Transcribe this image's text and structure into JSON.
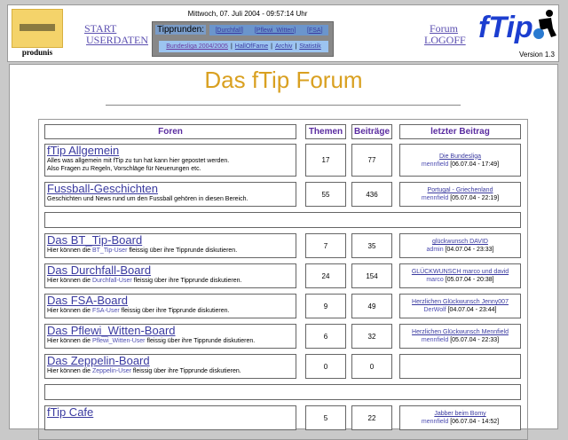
{
  "header": {
    "username": "produnis",
    "start": "START",
    "userdaten": "USERDATEN",
    "date": "Mittwoch, 07. Juli 2004 - 09:57:14 Uhr",
    "tipprunden_label": "Tipprunden:",
    "tipprunden": [
      "[Durchfall]",
      "[Pflewi_Witten]",
      "[FSA]"
    ],
    "links": [
      "Bundesliga 2004/2005",
      "HallOfFame",
      "Archiv",
      "Statistik"
    ],
    "forum": "Forum",
    "logoff": "LOGOFF",
    "logo": "fTip",
    "version": "Version 1.3"
  },
  "main": {
    "title": "Das fTip Forum",
    "columns": [
      "Foren",
      "Themen",
      "Beiträge",
      "letzter Beitrag"
    ],
    "forums": [
      {
        "name": "fTip Allgemein",
        "desc": "Alles was allgemein mit fTip zu tun hat kann hier gepostet werden.",
        "desc2": "Also Fragen zu Regeln, Vorschläge für Neuerungen etc.",
        "themen": "17",
        "beitraege": "77",
        "last_title": "Die Bundesliga",
        "last_user": "mennfield",
        "last_date": "[06.07.04 - 17:49]"
      },
      {
        "name": "Fussball-Geschichten",
        "desc": "Geschichten und News rund um den Fussball gehören in diesen Bereich.",
        "themen": "55",
        "beitraege": "436",
        "last_title": "Portugal - Griechenland",
        "last_user": "mennfield",
        "last_date": "[05.07.04 - 22:19]"
      },
      {
        "name": "Das BT_Tip-Board",
        "pre": "Hier können die ",
        "group": "BT_Tip-User",
        "post": " fleissig über ihre Tipprunde diskutieren.",
        "themen": "7",
        "beitraege": "35",
        "last_title": "glückwunsch DAVID",
        "last_user": "admin",
        "last_date": "[04.07.04 - 23:33]"
      },
      {
        "name": "Das Durchfall-Board",
        "pre": "Hier können die ",
        "group": "Durchfall-User",
        "post": " fleissig über ihre Tipprunde diskutieren.",
        "themen": "24",
        "beitraege": "154",
        "last_title": "GLÜCKWUNSCH marco und david",
        "last_user": "marco",
        "last_date": "[05.07.04 - 20:38]"
      },
      {
        "name": "Das FSA-Board",
        "pre": "Hier können die ",
        "group": "FSA-User",
        "post": " fleissig über ihre Tipprunde diskutieren.",
        "themen": "9",
        "beitraege": "49",
        "last_title": "Herzlichen Glückwunsch Jenny007",
        "last_user": "DerWolf",
        "last_date": "[04.07.04 - 23:44]"
      },
      {
        "name": "Das Pflewi_Witten-Board",
        "pre": "Hier können die ",
        "group": "Pflewi_Witten-User",
        "post": " fleissig über ihre Tipprunde diskutieren.",
        "themen": "6",
        "beitraege": "32",
        "last_title": "Herzlichen Glückwunsch Mennfield",
        "last_user": "mennfield",
        "last_date": "[05.07.04 - 22:33]"
      },
      {
        "name": "Das Zeppelin-Board",
        "pre": "Hier können die ",
        "group": "Zeppelin-User",
        "post": " fleissig über ihre Tipprunde diskutieren.",
        "themen": "0",
        "beitraege": "0"
      },
      {
        "name": "fTip Cafe",
        "themen": "5",
        "beitraege": "22",
        "last_title": "Jabber beim Bomy",
        "last_user": "mennfield",
        "last_date": "[06.07.04 - 14:52]"
      }
    ]
  }
}
